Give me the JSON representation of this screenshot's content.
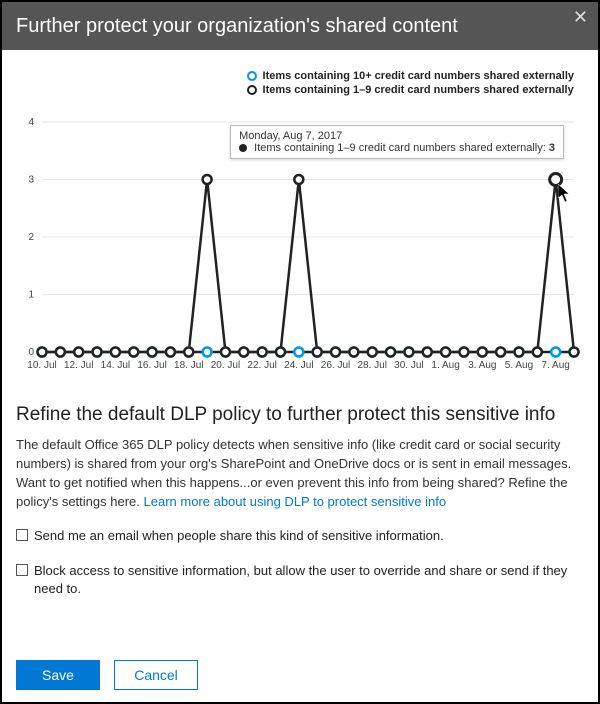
{
  "title": "Further protect your organization's shared content",
  "legend": {
    "series0": "Items containing 10+ credit card numbers shared externally",
    "series1": "Items containing 1–9 credit card numbers shared externally"
  },
  "tooltip": {
    "date": "Monday, Aug 7, 2017",
    "series_label": "Items containing 1–9 credit card numbers shared externally:",
    "value": "3"
  },
  "section": {
    "heading": "Refine the default DLP policy to further protect this sensitive info",
    "paragraph": "The default Office 365 DLP policy detects when sensitive info (like credit card or social security numbers) is shared from your org's SharePoint and OneDrive docs or is sent in email messages. Want to get notified when this happens...or even prevent this info from being shared? Refine the policy's settings here. ",
    "link": "Learn more about using DLP to protect sensitive info",
    "check1": "Send me an email when people share this kind of sensitive information.",
    "check2": "Block access to sensitive information, but allow the user to override and share or send if they need to."
  },
  "buttons": {
    "save": "Save",
    "cancel": "Cancel"
  },
  "chart_data": {
    "type": "line",
    "xlabel": "",
    "ylabel": "",
    "ylim": [
      0,
      4
    ],
    "x_tick_labels": [
      "10. Jul",
      "12. Jul",
      "14. Jul",
      "16. Jul",
      "18. Jul",
      "20. Jul",
      "22. Jul",
      "24. Jul",
      "26. Jul",
      "28. Jul",
      "30. Jul",
      "1. Aug",
      "3. Aug",
      "5. Aug",
      "7. Aug"
    ],
    "categories": [
      "10. Jul",
      "11. Jul",
      "12. Jul",
      "13. Jul",
      "14. Jul",
      "15. Jul",
      "16. Jul",
      "17. Jul",
      "18. Jul",
      "19. Jul",
      "20. Jul",
      "21. Jul",
      "22. Jul",
      "23. Jul",
      "24. Jul",
      "25. Jul",
      "26. Jul",
      "27. Jul",
      "28. Jul",
      "29. Jul",
      "30. Jul",
      "31. Jul",
      "1. Aug",
      "2. Aug",
      "3. Aug",
      "4. Aug",
      "5. Aug",
      "6. Aug",
      "7. Aug",
      "8. Aug"
    ],
    "series": [
      {
        "name": "Items containing 10+ credit card numbers shared externally",
        "values": [
          0,
          0,
          0,
          0,
          0,
          0,
          0,
          0,
          0,
          0,
          0,
          0,
          0,
          0,
          0,
          0,
          0,
          0,
          0,
          0,
          0,
          0,
          0,
          0,
          0,
          0,
          0,
          0,
          0,
          0
        ]
      },
      {
        "name": "Items containing 1–9 credit card numbers shared externally",
        "values": [
          0,
          0,
          0,
          0,
          0,
          0,
          0,
          0,
          0,
          3,
          0,
          0,
          0,
          0,
          3,
          0,
          0,
          0,
          0,
          0,
          0,
          0,
          0,
          0,
          0,
          0,
          0,
          0,
          3,
          0
        ]
      }
    ]
  }
}
